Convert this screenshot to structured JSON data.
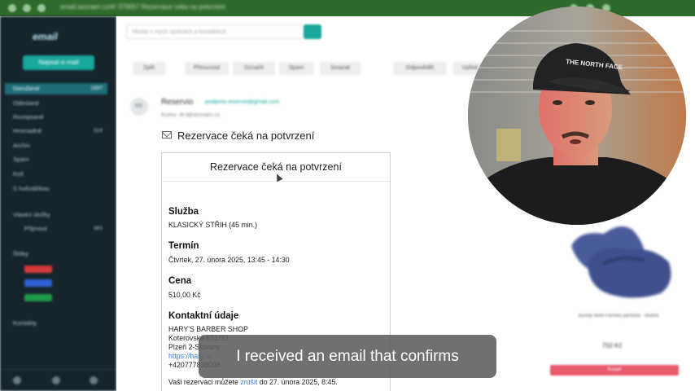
{
  "browser": {
    "address": "email.seznam.cz/#/ 370057 Rezervace ceka na potvrzeni"
  },
  "sidebar": {
    "logo": "email",
    "write_button": "Napsat e-mail",
    "items": [
      {
        "label": "Doručené",
        "count": "1657"
      },
      {
        "label": "Odeslané",
        "count": ""
      },
      {
        "label": "Rozepsané",
        "count": ""
      },
      {
        "label": "Hromadné",
        "count": "519"
      },
      {
        "label": "Archiv",
        "count": ""
      },
      {
        "label": "Spam",
        "count": ""
      },
      {
        "label": "Koš",
        "count": ""
      },
      {
        "label": "S hvězdičkou",
        "count": ""
      },
      {
        "label": "Vlastní složky",
        "count": ""
      },
      {
        "label": "Přijmout",
        "count": "983"
      },
      {
        "label": "Štítky",
        "count": ""
      },
      {
        "label": "Kontakty",
        "count": ""
      }
    ],
    "tag_colors": [
      "#d63a3a",
      "#2f62d6",
      "#1f9a4a"
    ]
  },
  "main": {
    "search_placeholder": "Hledat v mých zprávách a kontaktech",
    "toolbar": [
      "Zpět",
      "Přesunout",
      "Označit",
      "Spam",
      "Smazat",
      "Odpovědět",
      "Vpřed"
    ],
    "sender": {
      "avatar_initials": "RE",
      "name": "Reservio",
      "email": "podpora.reservio@gmail.com",
      "to": "Komu: dr.t@seznam.cz"
    },
    "subject": "Rezervace čeká na potvrzení"
  },
  "email": {
    "header": "Rezervace čeká na potvrzení",
    "service_label": "Služba",
    "service_value": "KLASICKÝ STŘIH (45 min.)",
    "date_label": "Termín",
    "date_value": "Čtvrtek, 27. února 2025, 13:45 - 14:30",
    "price_label": "Cena",
    "price_value": "510,00 Kč",
    "contact_label": "Kontaktní údaje",
    "contact_lines": [
      "HARY'S BARBER SHOP",
      "Koterovská 651/33",
      "Plzeň 2-Slovany",
      "https://hary-s-",
      "+420777838098"
    ],
    "cancel_prefix": "Vaši rezervaci můžete ",
    "cancel_link": "zrušit",
    "cancel_suffix": " do 27. února 2025, 8:45."
  },
  "ad": {
    "product": "Bundy textil Pánská pantofla - Modrá",
    "price": "750 Kč",
    "button": "Koupit"
  },
  "subtitle": "I received an email that confirms",
  "icons": [
    "mail-icon",
    "search-icon",
    "cursor-icon"
  ]
}
